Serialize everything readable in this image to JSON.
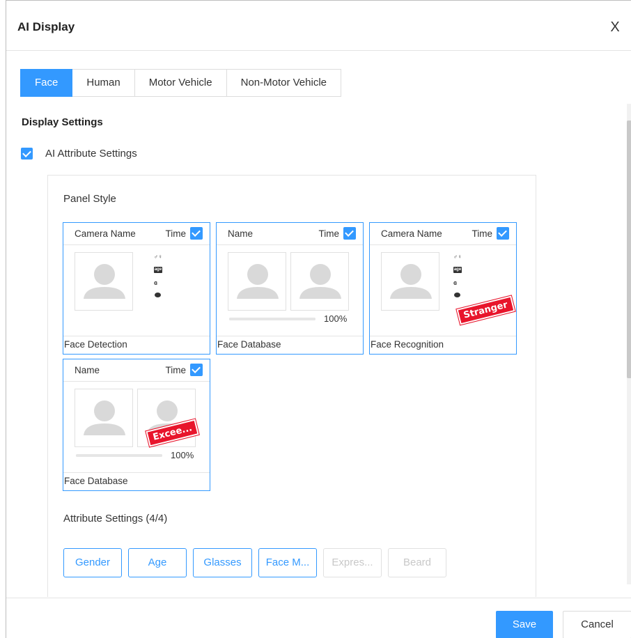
{
  "dialog": {
    "title": "AI Display",
    "close_icon": "close-icon",
    "close_glyph": "X"
  },
  "tabs": [
    {
      "label": "Face",
      "active": true
    },
    {
      "label": "Human",
      "active": false
    },
    {
      "label": "Motor Vehicle",
      "active": false
    },
    {
      "label": "Non-Motor Vehicle",
      "active": false
    }
  ],
  "display_settings": {
    "title": "Display Settings",
    "ai_attribute": {
      "label": "AI Attribute Settings",
      "checked": true
    },
    "panel_style_label": "Panel Style",
    "cards": [
      {
        "head_name": "Camera Name",
        "head_time": "Time",
        "time_checked": true,
        "footer": "Face Detection",
        "icons": [
          "gender-icon",
          "age-icon",
          "glasses-icon",
          "mask-icon"
        ]
      },
      {
        "head_name": "Name",
        "head_time": "Time",
        "time_checked": true,
        "footer": "Face Database",
        "similarity": "100%",
        "similarity_value": 1.0
      },
      {
        "head_name": "Camera Name",
        "head_time": "Time",
        "time_checked": true,
        "footer": "Face Recognition",
        "stamp": "Stranger",
        "icons": [
          "gender-icon",
          "age-icon",
          "glasses-icon",
          "mask-icon"
        ]
      },
      {
        "head_name": "Name",
        "head_time": "Time",
        "time_checked": true,
        "footer": "Face Database",
        "similarity": "100%",
        "similarity_value": 1.0,
        "stamp": "Excee..."
      }
    ],
    "attribute_settings_label": "Attribute Settings (4/4)",
    "attribute_buttons": [
      {
        "label": "Gender",
        "enabled": true
      },
      {
        "label": "Age",
        "enabled": true
      },
      {
        "label": "Glasses",
        "enabled": true
      },
      {
        "label": "Face M...",
        "enabled": true
      },
      {
        "label": "Expres...",
        "enabled": false
      },
      {
        "label": "Beard",
        "enabled": false
      }
    ]
  },
  "icon_glyphs": {
    "gender": "♂♀",
    "age": "age",
    "glasses": "ɞ"
  },
  "footer": {
    "save_label": "Save",
    "cancel_label": "Cancel"
  },
  "colors": {
    "accent": "#3399ff",
    "stamp": "#e8152c",
    "disabled": "#c8c8c8"
  }
}
